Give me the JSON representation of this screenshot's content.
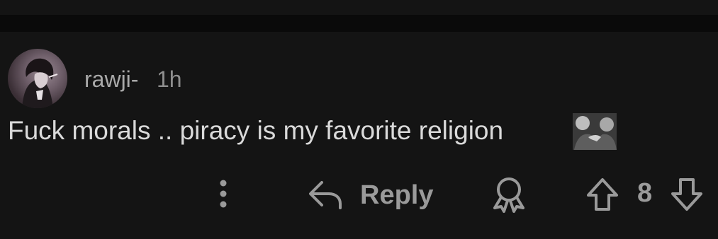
{
  "comment": {
    "username": "rawji-",
    "timestamp": "1h",
    "body": "Fuck morals .. piracy is my favorite religion",
    "score": "8"
  },
  "actions": {
    "more_icon": "vertical-dots-icon",
    "reply_icon": "reply-arrow-icon",
    "reply_label": "Reply",
    "award_icon": "award-ribbon-icon",
    "upvote_icon": "upvote-arrow-icon",
    "downvote_icon": "downvote-arrow-icon"
  },
  "colors": {
    "background": "#141414",
    "divider": "#0a0a0a",
    "text_primary": "#dadada",
    "text_muted": "#9a9a9a"
  }
}
